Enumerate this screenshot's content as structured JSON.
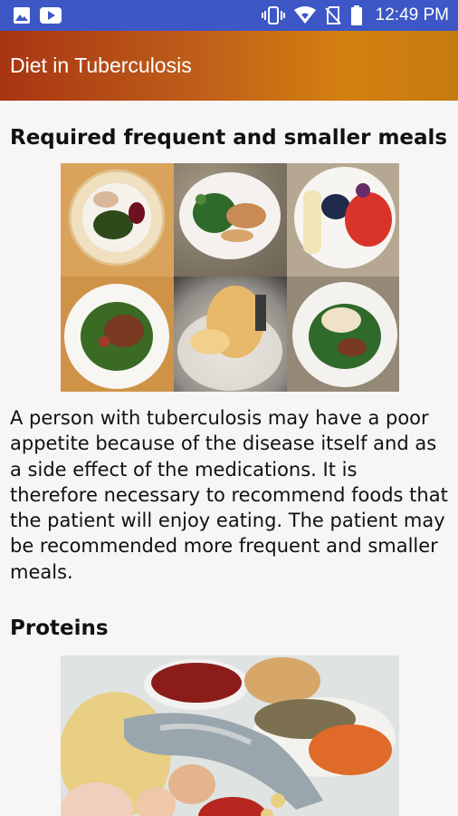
{
  "status_bar": {
    "time": "12:49 PM",
    "left_icons": [
      "image-icon",
      "youtube-icon"
    ],
    "right_icons": [
      "vibrate-icon",
      "wifi-icon",
      "no-sim-icon",
      "battery-icon"
    ],
    "color": "#3d57c6"
  },
  "app_bar": {
    "title": "Diet in Tuberculosis",
    "gradient": [
      "#a83512",
      "#d4800f"
    ]
  },
  "sections": [
    {
      "heading": "Required frequent and smaller meals",
      "image": "meals-collage-photo",
      "text": "A person with tuberculosis may have a poor appetite because of the disease itself and as a side effect of the medications. It is therefore necessary to recommend foods that the patient will enjoy eating. The patient may be recommended more frequent and smaller meals."
    },
    {
      "heading": "Proteins",
      "image": "protein-foods-photo"
    }
  ]
}
